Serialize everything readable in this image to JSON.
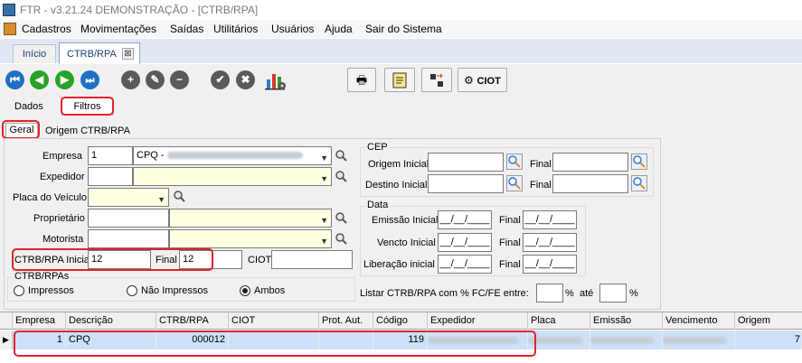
{
  "window": {
    "title": "FTR - v3.21.24   DEMONSTRAÇÃO - [CTRB/RPA]"
  },
  "menu": [
    "Cadastros",
    "Movimentações",
    "Saídas",
    "Utilitários",
    "Usuários",
    "Ajuda",
    "Sair do Sistema"
  ],
  "tabs": {
    "inicio": "Início",
    "ctrb": "CTRB/RPA",
    "close": "⊠"
  },
  "toolbar": {
    "first": "⏮",
    "prev": "◀",
    "next": "▶",
    "add": "+",
    "edit": "✎",
    "remove": "−",
    "confirm": "✔",
    "cancel": "✖",
    "ciot_label": "CIOT"
  },
  "subtabs": {
    "dados": "Dados",
    "filtros": "Filtros",
    "geral": "Geral",
    "origem": "Origem CTRB/RPA"
  },
  "filters": {
    "empresa_label": "Empresa",
    "empresa_code": "1",
    "empresa_name": "CPQ -",
    "expedidor_label": "Expedidor",
    "placa_label": "Placa do Veículo",
    "proprietario_label": "Proprietário",
    "motorista_label": "Motorista",
    "ctrb_inicial_label": "CTRB/RPA Inicial",
    "ctrb_inicial": "12",
    "final_label": "Final",
    "ctrb_final": "12",
    "ciot_label": "CIOT",
    "ctrbrpas_label": "CTRB/RPAs",
    "radio_impressos": "Impressos",
    "radio_nao_impressos": "Não Impressos",
    "radio_ambos": "Ambos",
    "cep_label": "CEP",
    "origem_inicial_label": "Origem Inicial",
    "destino_inicial_label": "Destino Inicial",
    "final_short": "Final",
    "data_label": "Data",
    "emissao_label": "Emissão Inicial",
    "vencto_label": "Vencto Inicial",
    "liberacao_label": "Liberação inicial",
    "date_mask": "__/__/____",
    "listar_label": "Listar CTRB/RPA com % FC/FE entre:",
    "percent": "%",
    "ate": "até"
  },
  "grid": {
    "headers": [
      "Empresa",
      "Descrição",
      "CTRB/RPA",
      "CIOT",
      "Prot. Aut.",
      "Código",
      "Expedidor",
      "Placa",
      "Emissão",
      "Vencimento",
      "Origem"
    ],
    "row": {
      "empresa": "1",
      "descricao": "CPQ",
      "ctrb": "000012",
      "codigo": "119",
      "origem_tail": "7"
    },
    "pointer": "▶"
  }
}
